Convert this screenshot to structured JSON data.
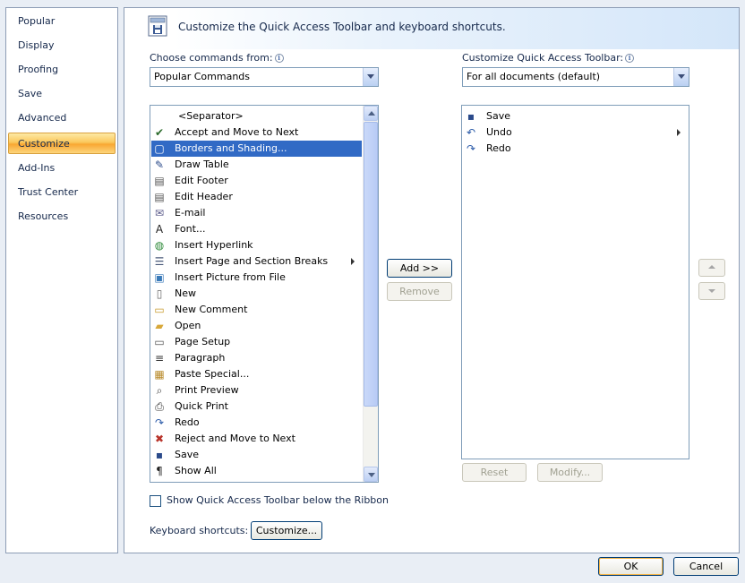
{
  "nav": {
    "items": [
      {
        "label": "Popular"
      },
      {
        "label": "Display"
      },
      {
        "label": "Proofing"
      },
      {
        "label": "Save"
      },
      {
        "label": "Advanced"
      },
      {
        "label": "Customize",
        "selected": true
      },
      {
        "label": "Add-Ins"
      },
      {
        "label": "Trust Center"
      },
      {
        "label": "Resources"
      }
    ]
  },
  "header": {
    "title": "Customize the Quick Access Toolbar and keyboard shortcuts."
  },
  "choose_commands": {
    "label": "Choose commands from:",
    "info": "i",
    "value": "Popular Commands"
  },
  "customize_qat": {
    "label": "Customize Quick Access Toolbar:",
    "info": "i",
    "value": "For all documents (default)"
  },
  "commands": [
    {
      "label": "<Separator>",
      "icon": "none"
    },
    {
      "label": "Accept and Move to Next",
      "icon": "accept-icon"
    },
    {
      "label": "Borders and Shading...",
      "icon": "borders-icon",
      "selected": true
    },
    {
      "label": "Draw Table",
      "icon": "draw-table-icon"
    },
    {
      "label": "Edit Footer",
      "icon": "edit-footer-icon"
    },
    {
      "label": "Edit Header",
      "icon": "edit-header-icon"
    },
    {
      "label": "E-mail",
      "icon": "email-icon"
    },
    {
      "label": "Font...",
      "icon": "font-icon"
    },
    {
      "label": "Insert Hyperlink",
      "icon": "hyperlink-icon"
    },
    {
      "label": "Insert Page and Section Breaks",
      "icon": "page-break-icon",
      "submenu": true
    },
    {
      "label": "Insert Picture from File",
      "icon": "picture-icon"
    },
    {
      "label": "New",
      "icon": "new-icon"
    },
    {
      "label": "New Comment",
      "icon": "comment-icon"
    },
    {
      "label": "Open",
      "icon": "open-icon"
    },
    {
      "label": "Page Setup",
      "icon": "page-setup-icon"
    },
    {
      "label": "Paragraph",
      "icon": "paragraph-icon"
    },
    {
      "label": "Paste Special...",
      "icon": "paste-icon"
    },
    {
      "label": "Print Preview",
      "icon": "print-preview-icon"
    },
    {
      "label": "Quick Print",
      "icon": "print-icon"
    },
    {
      "label": "Redo",
      "icon": "redo-icon"
    },
    {
      "label": "Reject and Move to Next",
      "icon": "reject-icon"
    },
    {
      "label": "Save",
      "icon": "save-icon"
    },
    {
      "label": "Show All",
      "icon": "pilcrow-icon"
    }
  ],
  "toolbar_items": [
    {
      "label": "Save",
      "icon": "save-icon"
    },
    {
      "label": "Undo",
      "icon": "undo-icon",
      "submenu": true
    },
    {
      "label": "Redo",
      "icon": "redo-icon"
    }
  ],
  "buttons": {
    "add": "Add >>",
    "remove": "Remove",
    "reset": "Reset",
    "modify": "Modify...",
    "customize": "Customize...",
    "ok": "OK",
    "cancel": "Cancel"
  },
  "show_below_ribbon": {
    "label": "Show Quick Access Toolbar below the Ribbon",
    "checked": false
  },
  "keyboard_shortcuts": {
    "label": "Keyboard shortcuts:"
  },
  "colors": {
    "selection": "#316ac5",
    "nav_selected": "#f9a732",
    "border": "#7f9db9"
  }
}
